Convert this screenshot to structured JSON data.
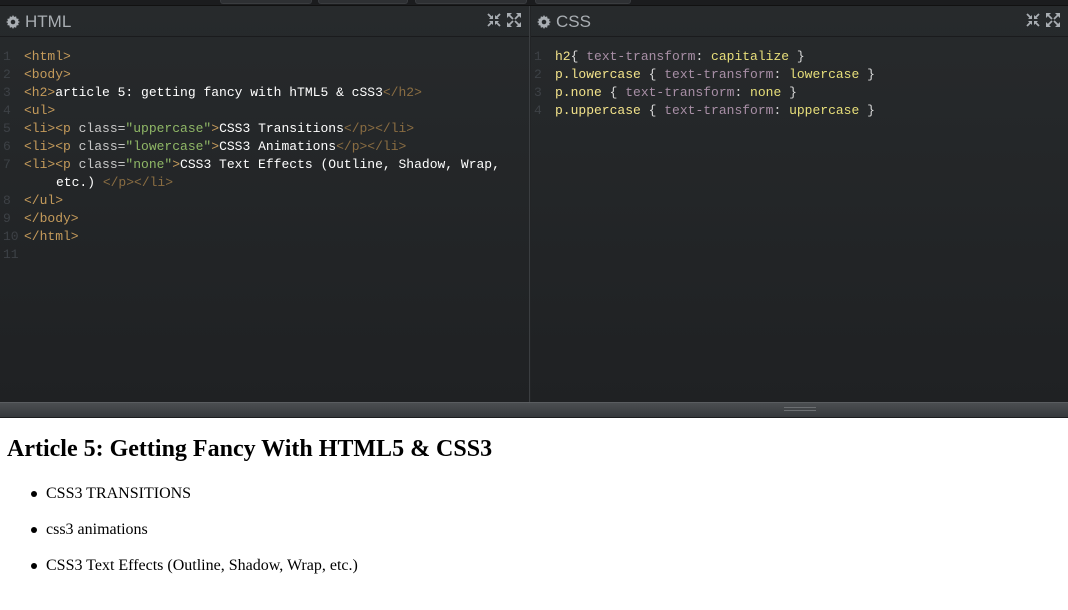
{
  "panes": {
    "html": {
      "title": "HTML",
      "icon": "gear-icon"
    },
    "css": {
      "title": "CSS",
      "icon": "gear-icon"
    }
  },
  "html_code": {
    "line_numbers": [
      "1",
      "2",
      "3",
      "4",
      "5",
      "6",
      "7",
      "8",
      "9",
      "10",
      "11"
    ],
    "l1": "<html>",
    "l2": "<body>",
    "l3_open": "<h2>",
    "l3_text": "article 5: getting fancy with hTML5 & cSS3",
    "l3_close": "</h2>",
    "l4": "<ul>",
    "li_open": "<li><p",
    "attr_class": " class=",
    "l5_val": "\"uppercase\"",
    "l5_text": "CSS3 Transitions",
    "l6_val": "\"lowercase\"",
    "l6_text": "CSS3 Animations",
    "l7_val": "\"none\"",
    "l7_text": "CSS3 Text Effects (Outline, Shadow, Wrap,",
    "l7_text_cont": "etc.) ",
    "li_close": "</p></li>",
    "l8": "</ul>",
    "l9": "</body>",
    "l10": "</html>"
  },
  "css_code": {
    "line_numbers": [
      "1",
      "2",
      "3",
      "4"
    ],
    "l1_sel": "h2",
    "l1_rest_open": "{ ",
    "prop": "text-transform",
    "colon": ": ",
    "l1_val": "capitalize",
    "close": " }",
    "l2_sel": "p.lowercase",
    "open": " { ",
    "l2_val": "lowercase",
    "l3_sel": "p.none",
    "l3_val": "none",
    "l4_sel": "p.uppercase",
    "l4_val": "uppercase"
  },
  "result": {
    "heading": "article 5: getting fancy with hTML5 & cSS3",
    "items": [
      {
        "text": "CSS3 Transitions",
        "transform": "uppercase"
      },
      {
        "text": "CSS3 Animations",
        "transform": "lowercase"
      },
      {
        "text": "CSS3 Text Effects (Outline, Shadow, Wrap, etc.)",
        "transform": "none"
      }
    ]
  },
  "colors": {
    "editor_bg": "#222426",
    "tag": "#c59b5b",
    "string": "#8fb766",
    "selector": "#f2e28a",
    "property": "#a88fa6"
  }
}
